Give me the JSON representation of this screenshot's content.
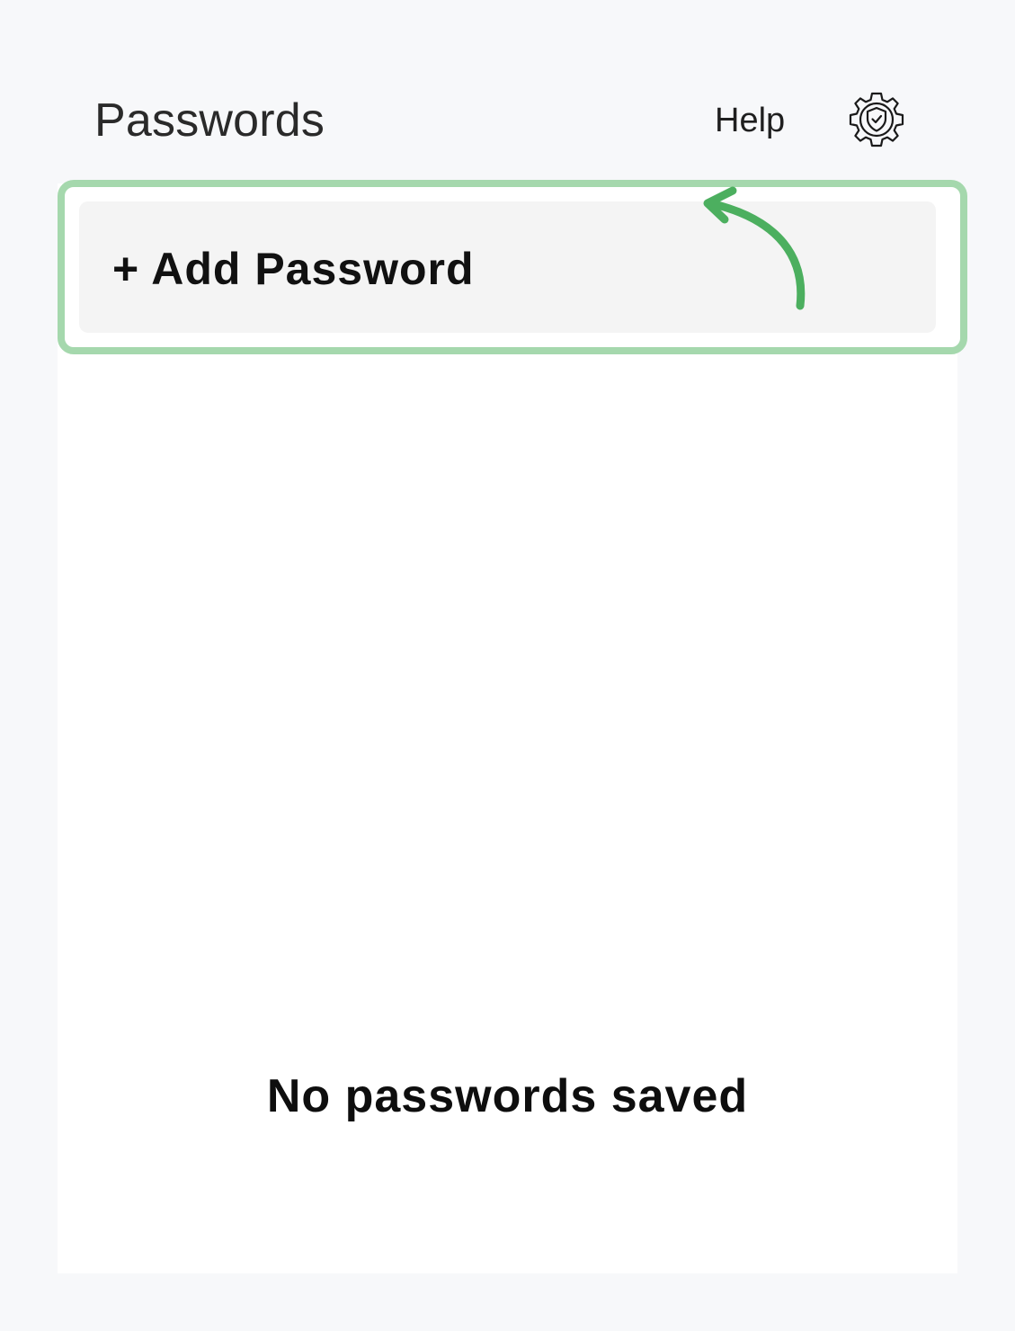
{
  "header": {
    "title": "Passwords",
    "help_label": "Help",
    "settings_icon": "security-settings-icon"
  },
  "actions": {
    "add_password_label": "+ Add Password"
  },
  "annotation": {
    "highlight_color": "#a5d8ad",
    "arrow_color": "#4caf5f",
    "arrow_icon": "curved-arrow-icon"
  },
  "empty_state": {
    "message": "No passwords saved"
  }
}
